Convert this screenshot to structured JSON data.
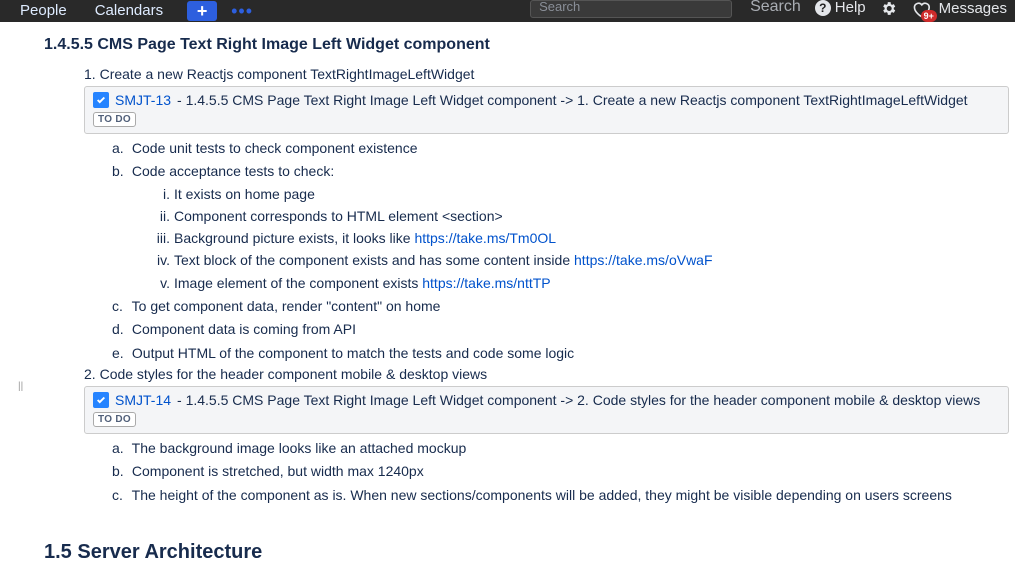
{
  "topbar": {
    "nav_people": "People",
    "nav_calendars": "Calendars",
    "create_glyph": "+",
    "more_glyph": "•••",
    "search_placeholder": "Search",
    "search_link": "Search",
    "help_label": "Help",
    "messages_label": "Messages",
    "messages_badge": "9+"
  },
  "section": {
    "heading": "1.4.5.5 CMS Page Text Right Image Left Widget component",
    "next_heading": "1.5 Server Architecture"
  },
  "item1": {
    "num": "1.",
    "title": "Create a new Reactjs component TextRightImageLeftWidget",
    "jira_key": "SMJT-13",
    "jira_sep": " - ",
    "jira_summary": "1.4.5.5 CMS Page Text Right Image Left Widget component -> 1. Create a new Reactjs component TextRightImageLeftWidget",
    "status": "TO DO",
    "a_lbl": "a.",
    "a": "Code unit tests to check component existence",
    "b_lbl": "b.",
    "b": "Code acceptance tests to check:",
    "b_i_lbl": "i.",
    "b_i": "It exists on home page",
    "b_ii_lbl": "ii.",
    "b_ii": "Component corresponds to HTML element <section>",
    "b_iii_lbl": "iii.",
    "b_iii_pre": "Background picture exists, it looks like  ",
    "b_iii_link": "https://take.ms/Tm0OL",
    "b_iv_lbl": "iv.",
    "b_iv_pre": "Text block of the component exists and has some content inside ",
    "b_iv_link": "https://take.ms/oVwaF",
    "b_v_lbl": "v.",
    "b_v_pre": "Image element of the component exists ",
    "b_v_link": "https://take.ms/nttTP",
    "c_lbl": "c.",
    "c": "To get component data, render \"content\" on home",
    "d_lbl": "d.",
    "d": "Component data is coming from API",
    "e_lbl": "e.",
    "e": "Output HTML of the component to match the tests and code some logic"
  },
  "item2": {
    "num": "2.",
    "title": "Code styles for the header component mobile & desktop views",
    "jira_key": "SMJT-14",
    "jira_sep": " - ",
    "jira_summary": "1.4.5.5 CMS Page Text Right Image Left Widget component -> 2. Code styles for the header component mobile & desktop views",
    "status": "TO DO",
    "a_lbl": "a.",
    "a": "The background image looks like an attached mockup",
    "b_lbl": "b.",
    "b": "Component is stretched, but width max 1240px",
    "c_lbl": "c.",
    "c": "The height of the component as is. When new sections/components will be added, they might be visible depending on users screens"
  },
  "gutter": "||"
}
